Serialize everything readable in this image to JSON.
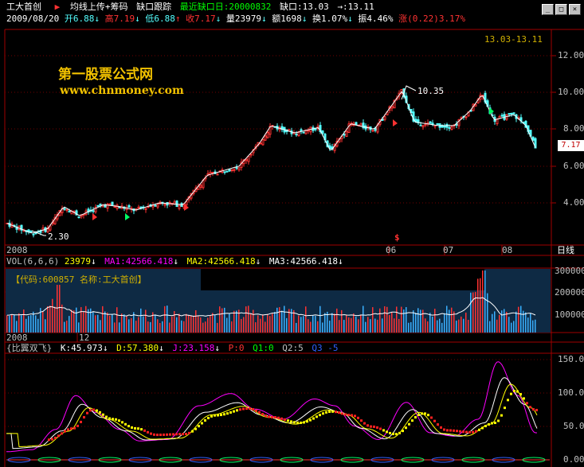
{
  "header": {
    "stock_name": "工大首创",
    "menu": [
      "均线上传+筹码",
      "缺口跟踪"
    ],
    "gap_label": "最近缺口日:",
    "gap_date": "20000832",
    "gap_text": "缺口:13.03",
    "gap_arrow": "→:13.11",
    "date": "2009/08/20",
    "open": "开6.88",
    "high": "高7.19",
    "low": "低6.88",
    "close": "收7.17",
    "volume": "量23979",
    "amount": "额1698",
    "turnover": "换1.07%",
    "amplitude": "振4.46%",
    "change": "涨(0.22)3.17%"
  },
  "window_buttons": [
    "_",
    "□",
    "×"
  ],
  "price_chart": {
    "y_ticks": [
      "12.00",
      "10.00",
      "8.00",
      "6.00",
      "4.00"
    ],
    "gap_range": "13.03-13.11",
    "high_marker": "10.35",
    "low_marker": "2.30",
    "current_price": "7.17",
    "x_labels": [
      "2008",
      "06",
      "07",
      "08"
    ],
    "period": "日线",
    "dollar_mark": "$"
  },
  "watermark": {
    "line1": "第一股票公式网",
    "line2": "www.chnmoney.com"
  },
  "volume_chart": {
    "legend": {
      "vol": "VOL(6,6,6)",
      "val": "23979",
      "ma1": "MA1:42566.418",
      "ma2": "MA2:42566.418",
      "ma3": "MA3:42566.418"
    },
    "stock_box": "【代码:600857 名称:工大首创】",
    "y_ticks": [
      "300000",
      "200000",
      "100000"
    ],
    "x_labels": [
      "2008",
      "12"
    ]
  },
  "kdj_chart": {
    "legend": {
      "name": "{比翼双飞}",
      "k": "K:45.973",
      "d": "D:57.380",
      "j": "J:23.158",
      "p": "P:0",
      "q1": "Q1:0",
      "q2": "Q2:5",
      "q3": "Q3 -5"
    },
    "y_ticks": [
      "150.00",
      "100.00",
      "50.00",
      "0.00"
    ]
  },
  "colors": {
    "up": "#ff3232",
    "down": "#54ffff",
    "grid": "#c00000",
    "ma": "#ffffff",
    "k": "#ffffff",
    "d": "#ffff00",
    "j": "#ff00ff"
  },
  "chart_data": {
    "type": "candlestick",
    "price_range": [
      2.3,
      10.35
    ],
    "ylim": [
      2.0,
      13.0
    ],
    "last_close": 7.17
  }
}
